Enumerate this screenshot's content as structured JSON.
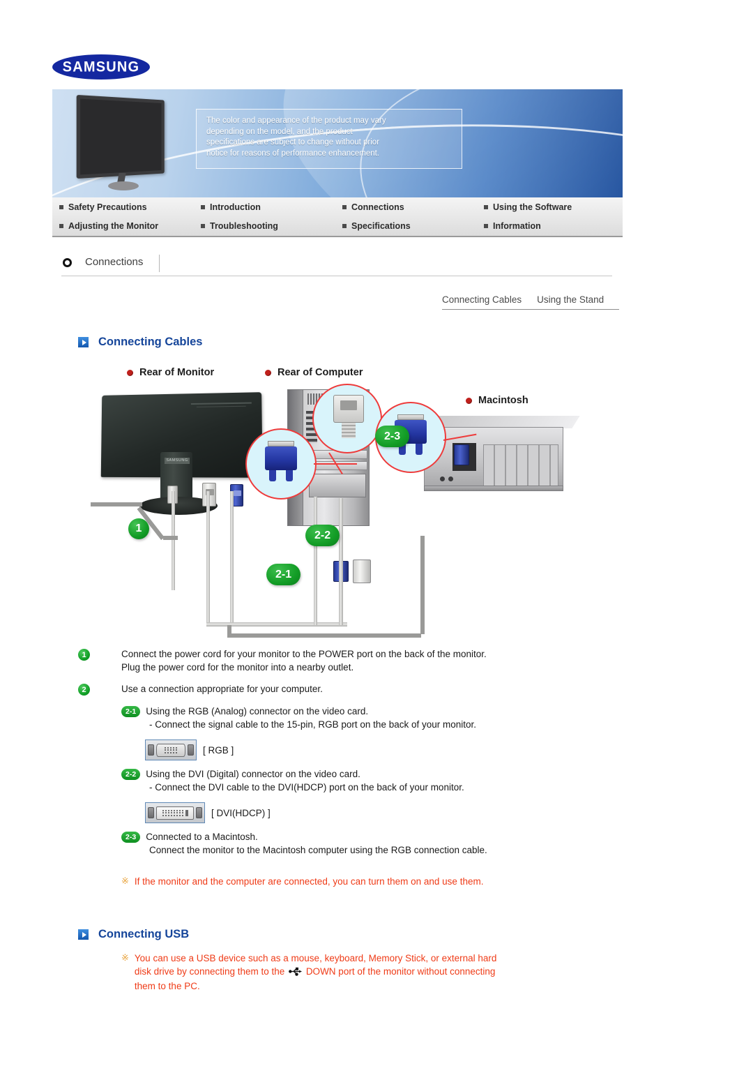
{
  "brand": {
    "logo_text": "SAMSUNG",
    "logo_color": "#1428a0"
  },
  "banner": {
    "notice_line1": "The color and appearance of the product may vary",
    "notice_line2": "depending on the model, and the product",
    "notice_line3": "specifications are subject to change without prior",
    "notice_line4": "notice for reasons of performance enhancement."
  },
  "nav": {
    "items": [
      {
        "label": "Safety Precautions"
      },
      {
        "label": "Introduction"
      },
      {
        "label": "Connections"
      },
      {
        "label": "Using the Software"
      },
      {
        "label": "Adjusting the Monitor"
      },
      {
        "label": "Troubleshooting"
      },
      {
        "label": "Specifications"
      },
      {
        "label": "Information"
      }
    ]
  },
  "section": {
    "title": "Connections"
  },
  "subtabs": [
    {
      "label": "Connecting Cables"
    },
    {
      "label": "Using the Stand"
    }
  ],
  "headings": {
    "cables": "Connecting Cables",
    "usb": "Connecting USB",
    "accent_color": "#15459a"
  },
  "diagram": {
    "label_monitor": "Rear of Monitor",
    "label_computer": "Rear of Computer",
    "label_macintosh": "Macintosh",
    "badge_1": "1",
    "badge_21": "2-1",
    "badge_22": "2-2",
    "badge_23": "2-3",
    "monitor_stand_text": "SAMSUNG",
    "badge_green": "#119b24",
    "callout_red": "#ee3b3b"
  },
  "steps": {
    "one": {
      "num": "1",
      "line1": "Connect the power cord for your monitor to the POWER port on the back of the monitor.",
      "line2": "Plug the power cord for the monitor into a nearby outlet."
    },
    "two": {
      "num": "2",
      "line1": "Use a connection appropriate for your computer.",
      "sub1": {
        "pill": "2-1",
        "title": "Using the RGB (Analog) connector on the video card.",
        "detail": "- Connect the signal cable to the 15-pin, RGB port on the back of your monitor.",
        "port_label": "[ RGB ]"
      },
      "sub2": {
        "pill": "2-2",
        "title": "Using the DVI (Digital) connector on the video card.",
        "detail": "- Connect the DVI cable to the DVI(HDCP) port on the back of your monitor.",
        "port_label": "[ DVI(HDCP) ]"
      },
      "sub3": {
        "pill": "2-3",
        "title": "Connected to a Macintosh.",
        "detail": "Connect the monitor to the Macintosh computer using the RGB connection cable."
      }
    },
    "note": {
      "mark": "※",
      "text": "If the monitor and the computer are connected, you can turn them on and use them."
    }
  },
  "usb": {
    "note_mark": "※",
    "line1": "You can use a USB device such as a mouse, keyboard, Memory Stick, or external hard",
    "line2a": "disk drive by connecting them to the",
    "line2b": "DOWN port of the monitor without connecting",
    "line3": "them to the PC.",
    "icon": "usb-icon",
    "text_color": "#ef3b17"
  }
}
